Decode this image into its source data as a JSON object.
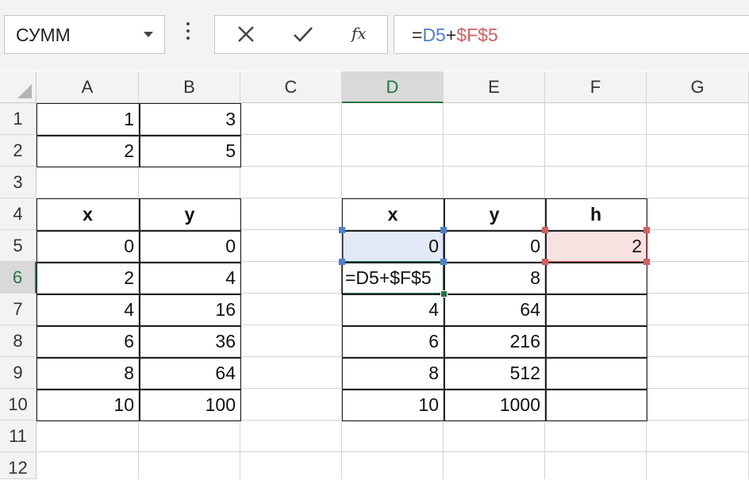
{
  "formula_bar": {
    "name_box": "СУММ",
    "formula_parts": [
      {
        "text": "=",
        "ref": "plain"
      },
      {
        "text": "D5",
        "ref": "ref-blue"
      },
      {
        "text": "+",
        "ref": "plain"
      },
      {
        "text": "$F$5",
        "ref": "ref-red"
      }
    ],
    "fx_label": "fx"
  },
  "columns": [
    "A",
    "B",
    "C",
    "D",
    "E",
    "F",
    "G"
  ],
  "rows": [
    "1",
    "2",
    "3",
    "4",
    "5",
    "6",
    "7",
    "8",
    "9",
    "10",
    "11",
    "12"
  ],
  "selected": {
    "column": "D",
    "row": "6"
  },
  "cells": {
    "A1": "1",
    "B1": "3",
    "A2": "2",
    "B2": "5",
    "A4": "x",
    "B4": "y",
    "A5": "0",
    "B5": "0",
    "A6": "2",
    "B6": "4",
    "A7": "4",
    "B7": "16",
    "A8": "6",
    "B8": "36",
    "A9": "8",
    "B9": "64",
    "A10": "10",
    "B10": "100",
    "D4": "x",
    "E4": "y",
    "F4": "h",
    "D5": "0",
    "E5": "0",
    "F5": "2",
    "D6": "=D5+$F$5",
    "E6": "8",
    "D7": "4",
    "E7": "64",
    "D8": "6",
    "E8": "216",
    "D9": "8",
    "E9": "512",
    "D10": "10",
    "E10": "1000"
  },
  "colors": {
    "accent": "#217346",
    "ref_blue": "#4f7fd0",
    "ref_red": "#d55d5d"
  },
  "icons": {
    "cancel": "x-icon",
    "enter": "checkmark-icon",
    "function": "fx-icon",
    "name_box_dropdown": "chevron-down-icon"
  }
}
